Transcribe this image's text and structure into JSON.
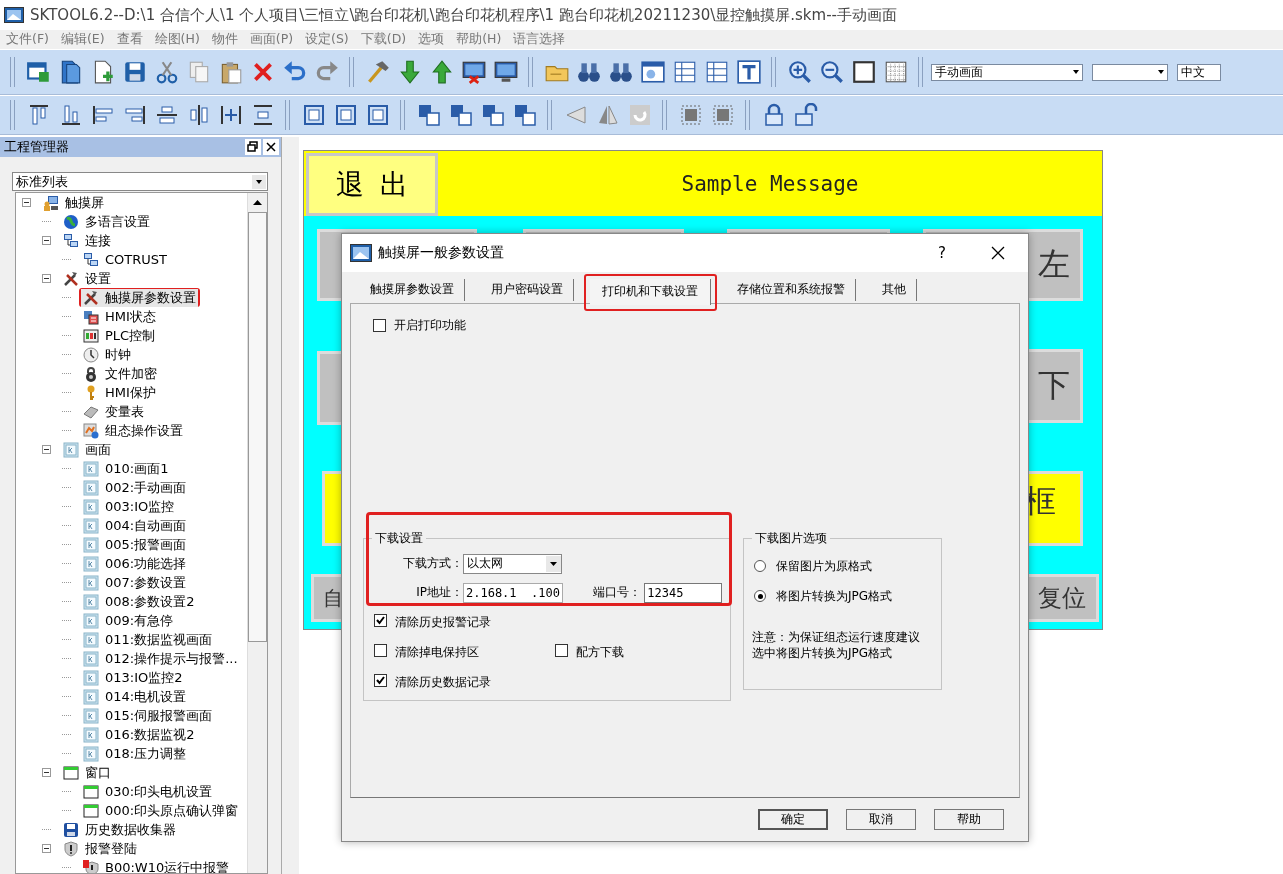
{
  "window": {
    "title": "SKTOOL6.2--D:\\1 合信个人\\1 个人项目\\三恒立\\跑台印花机\\跑台印花机程序\\1 跑台印花机20211230\\显控触摸屏.skm--手动画面"
  },
  "menu": [
    "文件(F)",
    "编辑(E)",
    "查看",
    "绘图(H)",
    "物件",
    "画面(P)",
    "设定(S)",
    "下载(D)",
    "选项",
    "帮助(H)",
    "语言选择"
  ],
  "toolbar": {
    "screen_select": "手动画面",
    "language_select": "中文"
  },
  "project_manager": {
    "title": "工程管理器",
    "view_select": "标准列表",
    "tree": [
      {
        "label": "触摸屏",
        "kind": "device",
        "expanded": true,
        "selected": false,
        "marked": false,
        "children": [
          {
            "label": "多语言设置",
            "kind": "globe",
            "selected": false,
            "marked": false
          },
          {
            "label": "连接",
            "kind": "network",
            "expanded": true,
            "selected": false,
            "marked": false,
            "children": [
              {
                "label": "COTRUST",
                "kind": "network",
                "selected": false,
                "marked": false
              }
            ]
          },
          {
            "label": "设置",
            "kind": "tools",
            "expanded": true,
            "selected": false,
            "marked": false,
            "children": [
              {
                "label": "触摸屏参数设置",
                "kind": "tools",
                "selected": true,
                "marked": true
              },
              {
                "label": "HMI状态",
                "kind": "status",
                "selected": false,
                "marked": false
              },
              {
                "label": "PLC控制",
                "kind": "plc",
                "selected": false,
                "marked": false
              },
              {
                "label": "时钟",
                "kind": "clock",
                "selected": false,
                "marked": false
              },
              {
                "label": "文件加密",
                "kind": "lock",
                "selected": false,
                "marked": false
              },
              {
                "label": "HMI保护",
                "kind": "key",
                "selected": false,
                "marked": false
              },
              {
                "label": "变量表",
                "kind": "table",
                "selected": false,
                "marked": false
              },
              {
                "label": "组态操作设置",
                "kind": "config",
                "selected": false,
                "marked": false
              }
            ]
          },
          {
            "label": "画面",
            "kind": "screen",
            "expanded": true,
            "selected": false,
            "marked": false,
            "children": [
              {
                "label": "010:画面1",
                "kind": "screen",
                "selected": false,
                "marked": false
              },
              {
                "label": "002:手动画面",
                "kind": "screen",
                "selected": false,
                "marked": false
              },
              {
                "label": "003:IO监控",
                "kind": "screen",
                "selected": false,
                "marked": false
              },
              {
                "label": "004:自动画面",
                "kind": "screen",
                "selected": false,
                "marked": false
              },
              {
                "label": "005:报警画面",
                "kind": "screen",
                "selected": false,
                "marked": false
              },
              {
                "label": "006:功能选择",
                "kind": "screen",
                "selected": false,
                "marked": false
              },
              {
                "label": "007:参数设置",
                "kind": "screen",
                "selected": false,
                "marked": false
              },
              {
                "label": "008:参数设置2",
                "kind": "screen",
                "selected": false,
                "marked": false
              },
              {
                "label": "009:有急停",
                "kind": "screen",
                "selected": false,
                "marked": false
              },
              {
                "label": "011:数据监视画面",
                "kind": "screen",
                "selected": false,
                "marked": false
              },
              {
                "label": "012:操作提示与报警...",
                "kind": "screen",
                "selected": false,
                "marked": false
              },
              {
                "label": "013:IO监控2",
                "kind": "screen",
                "selected": false,
                "marked": false
              },
              {
                "label": "014:电机设置",
                "kind": "screen",
                "selected": false,
                "marked": false
              },
              {
                "label": "015:伺服报警画面",
                "kind": "screen",
                "selected": false,
                "marked": false
              },
              {
                "label": "016:数据监视2",
                "kind": "screen",
                "selected": false,
                "marked": false
              },
              {
                "label": "018:压力调整",
                "kind": "screen",
                "selected": false,
                "marked": false
              }
            ]
          },
          {
            "label": "窗口",
            "kind": "window",
            "expanded": true,
            "selected": false,
            "marked": false,
            "children": [
              {
                "label": "030:印头电机设置",
                "kind": "window",
                "selected": false,
                "marked": false
              },
              {
                "label": "000:印头原点确认弹窗",
                "kind": "window",
                "selected": false,
                "marked": false
              }
            ]
          },
          {
            "label": "历史数据收集器",
            "kind": "disk",
            "selected": false,
            "marked": false
          },
          {
            "label": "报警登陆",
            "kind": "alarm",
            "expanded": true,
            "selected": false,
            "marked": false,
            "children": [
              {
                "label": "B00:W10运行中报警",
                "kind": "alarmitem",
                "selected": false,
                "marked": false
              }
            ]
          }
        ]
      }
    ]
  },
  "hmi_screen": {
    "exit_button": "退出",
    "message": "Sample Message",
    "buttons": [
      {
        "color": "#c0c0c0"
      },
      {
        "color": "#c0c0c0"
      },
      {
        "color": "#c0c0c0"
      },
      {
        "label": "左",
        "color": "#c0c0c0"
      },
      {
        "color": "#c0c0c0"
      },
      {
        "label": "下",
        "color": "#c0c0c0"
      },
      {
        "color": "#ffff00"
      },
      {
        "label": "框",
        "color": "#ffff00"
      },
      {
        "label": "自",
        "color": "#c0c0c0"
      },
      {
        "label": "复位",
        "color": "#c0c0c0"
      }
    ]
  },
  "dialog": {
    "title": "触摸屏一般参数设置",
    "help": "?",
    "tabs": [
      {
        "label": "触摸屏参数设置",
        "selected": false,
        "marked": false
      },
      {
        "label": "用户密码设置",
        "selected": false,
        "marked": false
      },
      {
        "label": "打印机和下载设置",
        "selected": true,
        "marked": true
      },
      {
        "label": "存储位置和系统报警",
        "selected": false,
        "marked": false
      },
      {
        "label": "其他",
        "selected": false,
        "marked": false
      }
    ],
    "enable_print": {
      "label": "开启打印功能",
      "checked": false
    },
    "download_settings": {
      "legend": "下载设置",
      "marked": true,
      "method_label": "下载方式：",
      "method_value": "以太网",
      "ip_label": "IP地址：",
      "ip_value": "2.168.1  .100",
      "port_label": "端口号：",
      "port_value": "12345",
      "options": [
        {
          "label": "清除历史报警记录",
          "checked": true
        },
        {
          "label": "清除掉电保持区",
          "checked": false
        },
        {
          "label": "配方下载",
          "checked": false
        },
        {
          "label": "清除历史数据记录",
          "checked": true
        }
      ]
    },
    "picture_options": {
      "legend": "下载图片选项",
      "radios": [
        {
          "label": "保留图片为原格式",
          "selected": false
        },
        {
          "label": "将图片转换为JPG格式",
          "selected": true
        }
      ],
      "note": "注意：为保证组态运行速度建议选中将图片转换为JPG格式"
    },
    "buttons": [
      "确定",
      "取消",
      "帮助"
    ]
  }
}
